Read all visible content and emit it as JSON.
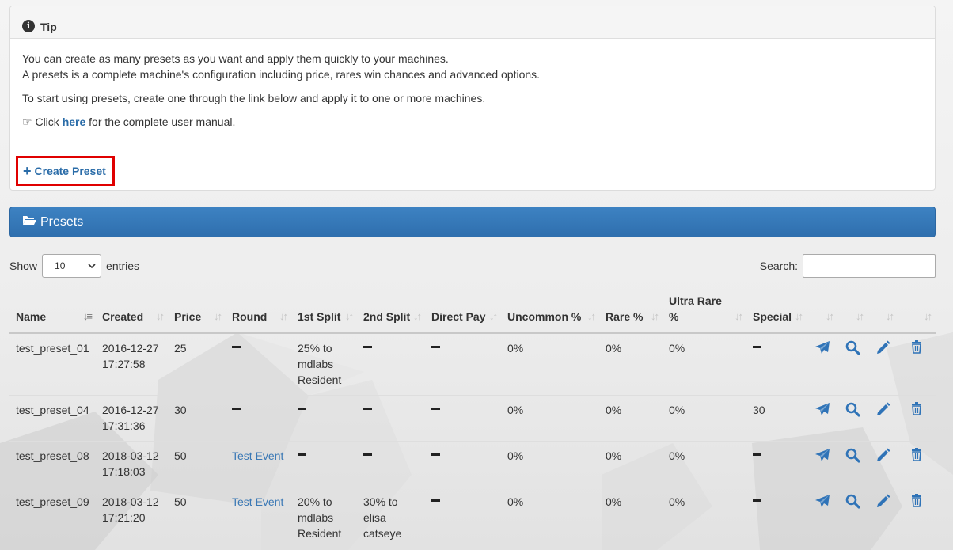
{
  "tip": {
    "title": "Tip",
    "line1": "You can create as many presets as you want and apply them quickly to your machines.",
    "line2": "A presets is a complete machine's configuration including price, rares win chances and advanced options.",
    "line3": "To start using presets, create one through the link below and apply it to one or more machines.",
    "manual_pre": "Click",
    "manual_link": "here",
    "manual_post": "for the complete user manual.",
    "create_label": "Create Preset"
  },
  "presets_panel": {
    "title": "Presets"
  },
  "controls": {
    "show_label": "Show",
    "page_length": "10",
    "entries_label": "entries",
    "search_label": "Search:",
    "search_value": ""
  },
  "table": {
    "headers": [
      "Name",
      "Created",
      "Price",
      "Round",
      "1st Split",
      "2nd Split",
      "Direct Pay",
      "Uncommon %",
      "Rare %",
      "Ultra Rare %",
      "Special",
      "",
      "",
      "",
      ""
    ],
    "rows": [
      {
        "name": "test_preset_01",
        "created_date": "2016-12-27",
        "created_time": "17:27:58",
        "price": "25",
        "round": "",
        "split1": [
          "25% to",
          "mdlabs",
          "Resident"
        ],
        "split2": [],
        "direct_pay": "",
        "uncommon": "0%",
        "rare": "0%",
        "ultra_rare": "0%",
        "special": ""
      },
      {
        "name": "test_preset_04",
        "created_date": "2016-12-27",
        "created_time": "17:31:36",
        "price": "30",
        "round": "",
        "split1": [],
        "split2": [],
        "direct_pay": "",
        "uncommon": "0%",
        "rare": "0%",
        "ultra_rare": "0%",
        "special": "30"
      },
      {
        "name": "test_preset_08",
        "created_date": "2018-03-12",
        "created_time": "17:18:03",
        "price": "50",
        "round": "Test Event",
        "split1": [],
        "split2": [],
        "direct_pay": "",
        "uncommon": "0%",
        "rare": "0%",
        "ultra_rare": "0%",
        "special": ""
      },
      {
        "name": "test_preset_09",
        "created_date": "2018-03-12",
        "created_time": "17:21:20",
        "price": "50",
        "round": "Test Event",
        "split1": [
          "20% to",
          "mdlabs",
          "Resident"
        ],
        "split2": [
          "30% to",
          "elisa",
          "catseye"
        ],
        "direct_pay": "",
        "uncommon": "0%",
        "rare": "0%",
        "ultra_rare": "0%",
        "special": ""
      }
    ]
  },
  "icons": {
    "action_color": "#2f73b7",
    "send": "paper-plane-icon",
    "view": "search-icon",
    "edit": "pencil-icon",
    "delete": "trash-icon"
  }
}
